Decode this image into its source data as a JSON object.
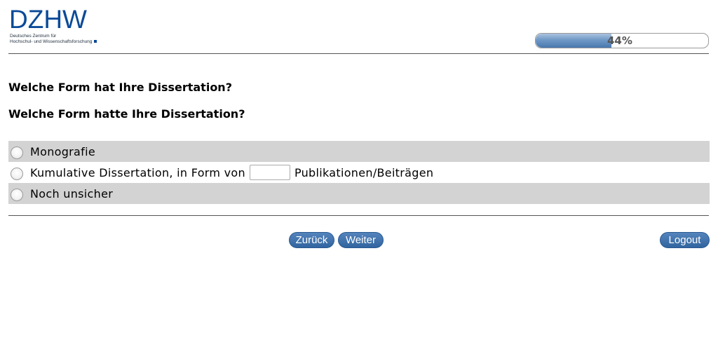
{
  "header": {
    "logo_text": "DZHW",
    "logo_subtitle_line1": "Deutsches Zentrum für",
    "logo_subtitle_line2": "Hochschul- und Wissenschaftsforschung",
    "progress": {
      "percent": 44,
      "label": "44%"
    }
  },
  "questions": {
    "q1": "Welche Form hat Ihre Dissertation?",
    "q2": "Welche Form hatte Ihre Dissertation?"
  },
  "options": [
    {
      "label": "Monografie"
    },
    {
      "label_before": "Kumulative Dissertation, in Form von",
      "input_value": "",
      "label_after": "Publikationen/Beiträgen"
    },
    {
      "label": "Noch unsicher"
    }
  ],
  "nav": {
    "back": "Zurück",
    "next": "Weiter",
    "logout": "Logout"
  },
  "colors": {
    "brand_blue": "#0a4a98",
    "button_blue": "#3a6ea8",
    "option_shade": "#d3d3d3"
  }
}
